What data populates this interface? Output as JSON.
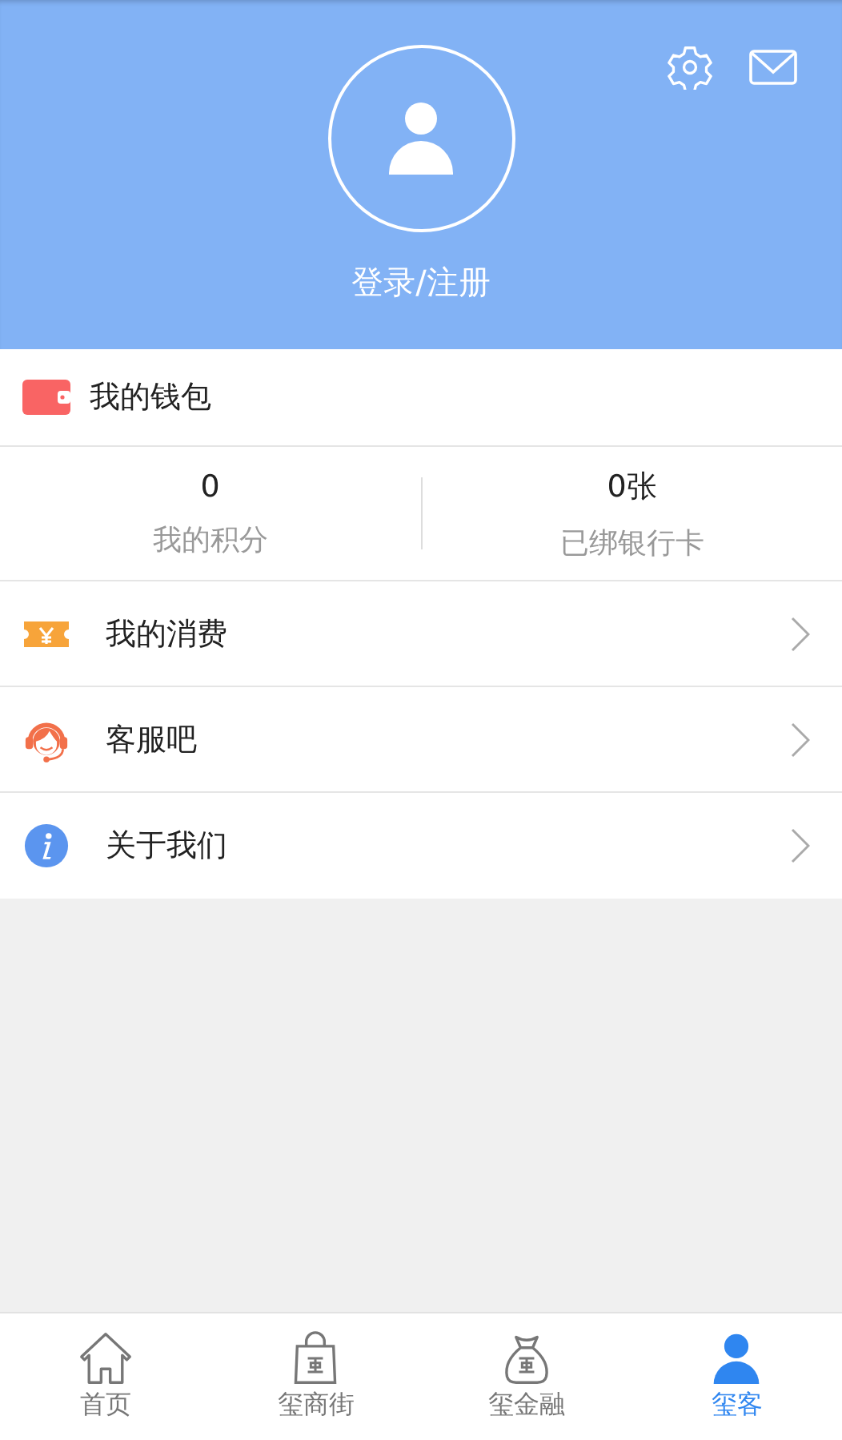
{
  "header": {
    "login_label": "登录/注册"
  },
  "wallet": {
    "title": "我的钱包"
  },
  "stats": [
    {
      "value": "0",
      "label": "我的积分"
    },
    {
      "value": "0张",
      "label": "已绑银行卡"
    }
  ],
  "menu": [
    {
      "kind": "ticket",
      "label": "我的消费"
    },
    {
      "kind": "headset",
      "label": "客服吧"
    },
    {
      "kind": "info",
      "label": "关于我们"
    }
  ],
  "tabs": [
    {
      "kind": "home",
      "label": "首页",
      "selected": false
    },
    {
      "kind": "bag",
      "label": "玺商街",
      "selected": false
    },
    {
      "kind": "sack",
      "label": "玺金融",
      "selected": false
    },
    {
      "kind": "person",
      "label": "玺客",
      "selected": true
    }
  ]
}
